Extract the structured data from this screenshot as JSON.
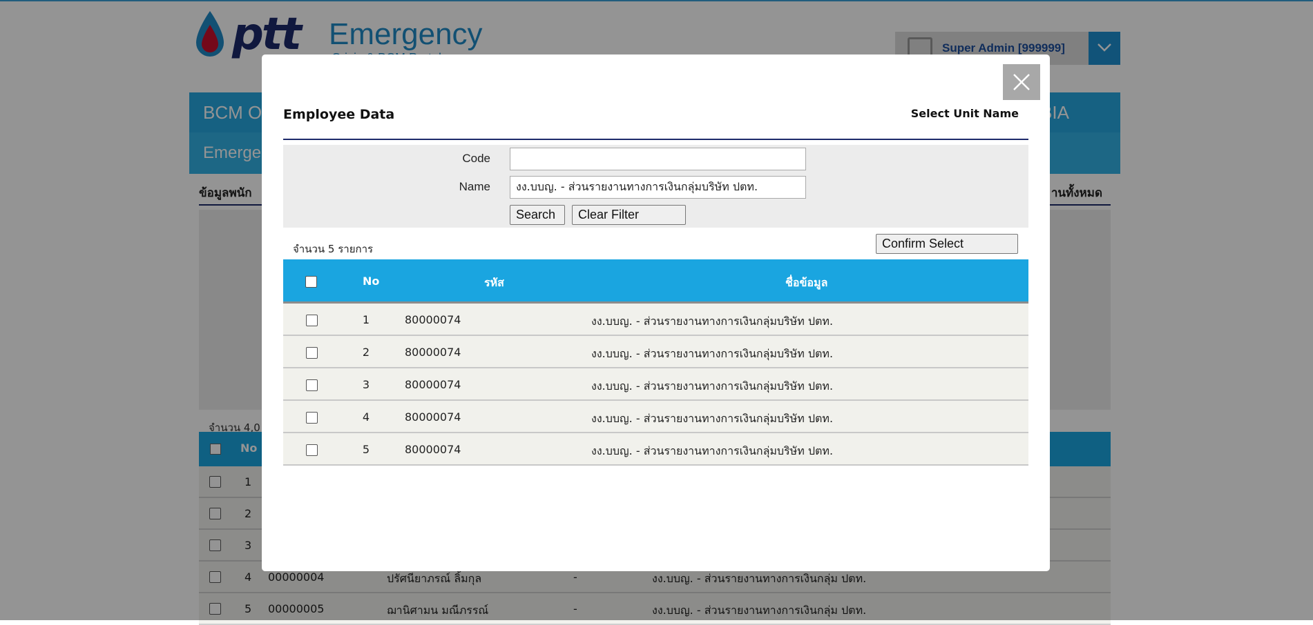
{
  "background": {
    "logo": {
      "brand": "ptt",
      "title": "Emergency",
      "subtitle": "Crisis & BCM Portal"
    },
    "user": {
      "name": "Super Admin [999999]"
    },
    "nav": {
      "primary_left": "BCM O",
      "primary_right": "BIA",
      "secondary_left": "Emerge"
    },
    "section": {
      "title_left": "ข้อมูลพนัก",
      "title_right": "านทั้งหมด"
    },
    "count_text": "จำนวน 4,0",
    "table_header": {
      "no": "No"
    },
    "rows": [
      {
        "no": "1"
      },
      {
        "no": "2"
      },
      {
        "no": "3"
      },
      {
        "no": "4",
        "code": "00000004",
        "name": "ปรัศนียาภรณ์ ลิ้มกุล",
        "dash": "-",
        "unit": "งง.บบญ. - ส่วนรายงานทางการเงินกลุ่ม ปตท."
      },
      {
        "no": "5",
        "code": "00000005",
        "name": "ฌานิศามน มณีภรรณ์",
        "dash": "-",
        "unit": "งง.บบญ. - ส่วนรายงานทางการเงินกลุ่ม ปตท."
      }
    ]
  },
  "modal": {
    "title": "Employee Data",
    "unit_label": "Select Unit Name",
    "filter": {
      "code_label": "Code",
      "code_value": "",
      "name_label": "Name",
      "name_value": "งง.บบญ. - ส่วนรายงานทางการเงินกลุ่มบริษัท ปตท.",
      "search_button": "Search",
      "clear_button": "Clear Filter"
    },
    "count_text": "จำนวน 5 รายการ",
    "confirm_button": "Confirm Select",
    "table": {
      "headers": {
        "no": "No",
        "code": "รหัส",
        "name": "ชื่อข้อมูล"
      },
      "rows": [
        {
          "no": "1",
          "code": "80000074",
          "name": "งง.บบญ. - ส่วนรายงานทางการเงินกลุ่มบริษัท ปตท."
        },
        {
          "no": "2",
          "code": "80000074",
          "name": "งง.บบญ. - ส่วนรายงานทางการเงินกลุ่มบริษัท ปตท."
        },
        {
          "no": "3",
          "code": "80000074",
          "name": "งง.บบญ. - ส่วนรายงานทางการเงินกลุ่มบริษัท ปตท."
        },
        {
          "no": "4",
          "code": "80000074",
          "name": "งง.บบญ. - ส่วนรายงานทางการเงินกลุ่มบริษัท ปตท."
        },
        {
          "no": "5",
          "code": "80000074",
          "name": "งง.บบญ. - ส่วนรายงานทางการเงินกลุ่มบริษัท ปตท."
        }
      ]
    }
  },
  "colors": {
    "header_blue": "#1aa5e0",
    "navy": "#1d2a6b",
    "overlay": "rgba(0,0,0,0.42)"
  }
}
